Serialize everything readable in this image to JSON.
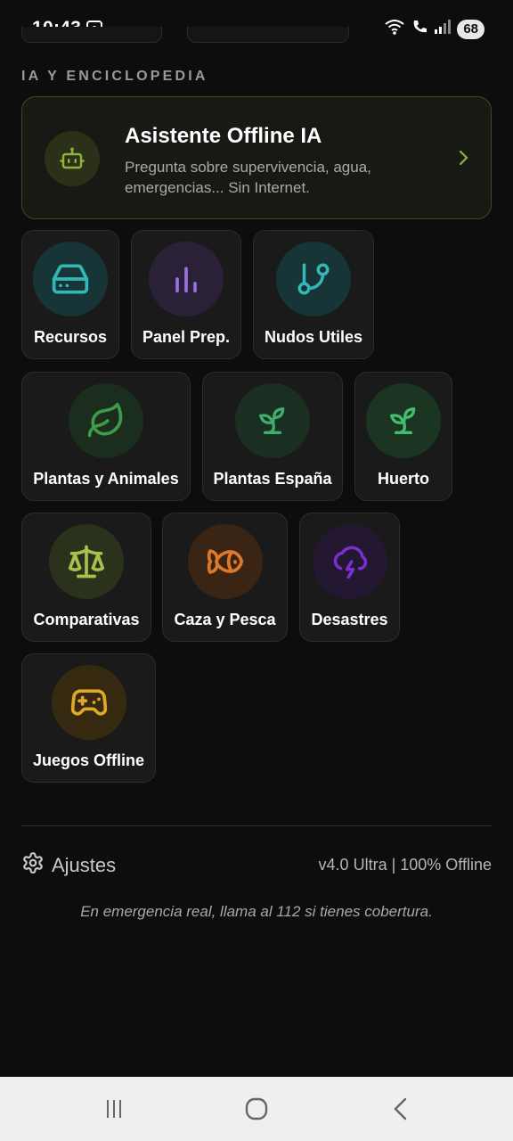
{
  "status": {
    "time": "10:43",
    "battery": "68"
  },
  "section": {
    "title": "IA Y ENCICLOPEDIA"
  },
  "assistant": {
    "title": "Asistente Offline IA",
    "description": "Pregunta sobre supervivencia, agua, emergencias... Sin Internet.",
    "icon": "robot-icon",
    "accent": "#8db33a"
  },
  "tiles": [
    {
      "label": "Recursos",
      "icon": "storage-icon",
      "color": "#35b7b7",
      "bg": "#173536"
    },
    {
      "label": "Panel Prep.",
      "icon": "bar-chart-icon",
      "color": "#9b6fe0",
      "bg": "#2a2138"
    },
    {
      "label": "Nudos Utiles",
      "icon": "branch-icon",
      "color": "#35b7b7",
      "bg": "#173536"
    },
    {
      "label": "Plantas y Animales",
      "icon": "leaf-icon",
      "color": "#3f9b4a",
      "bg": "#1b2e1e"
    },
    {
      "label": "Plantas España",
      "icon": "sprout-icon",
      "color": "#3fae6a",
      "bg": "#1b2e22"
    },
    {
      "label": "Huerto",
      "icon": "sprout-icon",
      "color": "#3ec06a",
      "bg": "#1b3522"
    },
    {
      "label": "Comparativas",
      "icon": "scale-icon",
      "color": "#a6c24a",
      "bg": "#2a321c"
    },
    {
      "label": "Caza y Pesca",
      "icon": "fish-icon",
      "color": "#e0782a",
      "bg": "#3a2414"
    },
    {
      "label": "Desastres",
      "icon": "storm-icon",
      "color": "#7a2fd0",
      "bg": "#231732"
    },
    {
      "label": "Juegos Offline",
      "icon": "gamepad-icon",
      "color": "#e0a82a",
      "bg": "#35290f"
    }
  ],
  "footer": {
    "settings_label": "Ajustes",
    "version": "v4.0 Ultra | 100% Offline",
    "disclaimer": "En emergencia real, llama al 112 si tienes cobertura."
  }
}
